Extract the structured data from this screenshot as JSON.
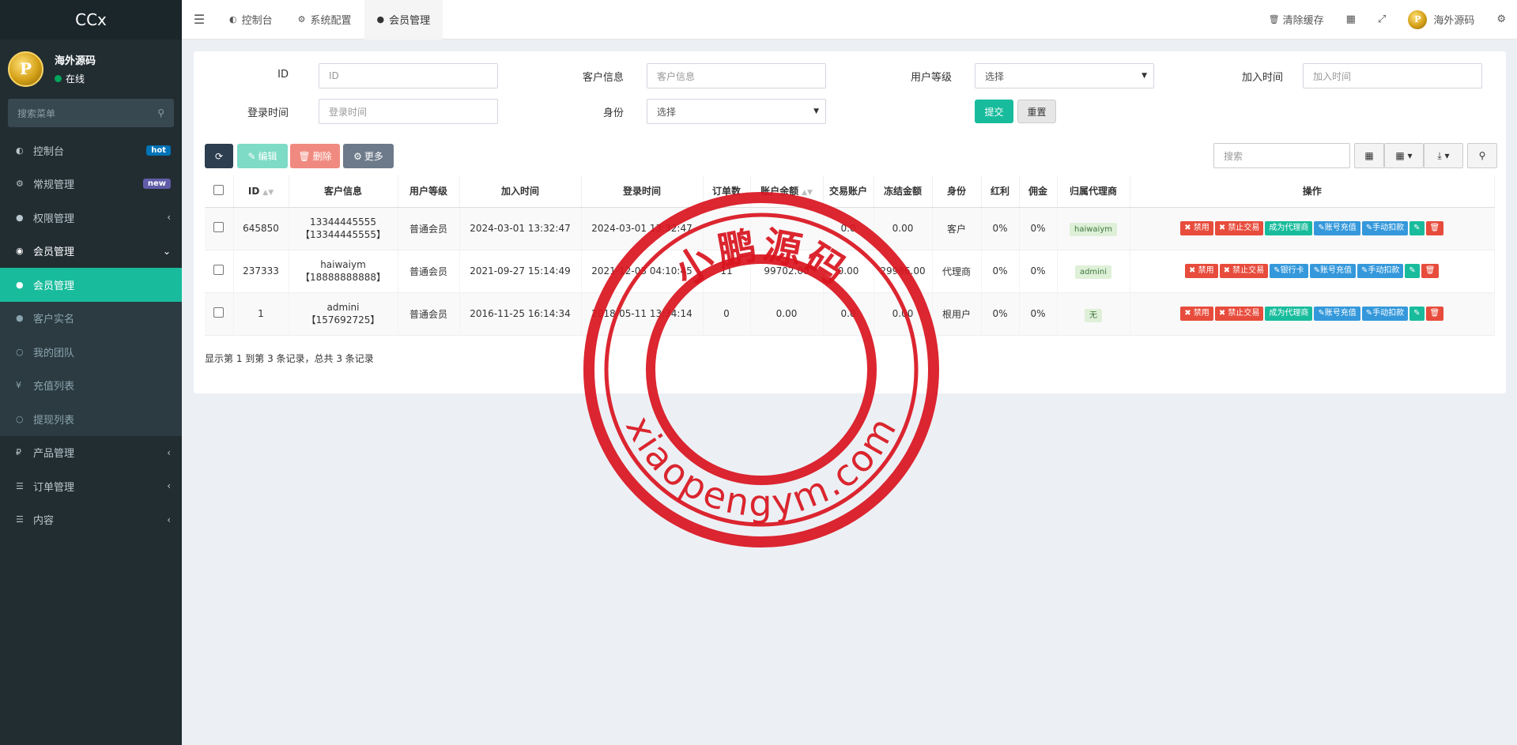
{
  "brand": "CCx",
  "user": {
    "name": "海外源码",
    "status": "在线",
    "avatar_letter": "P"
  },
  "sidebar": {
    "search_placeholder": "搜索菜单",
    "items": [
      {
        "label": "控制台",
        "icon": "dashboard-icon",
        "badge": "hot"
      },
      {
        "label": "常规管理",
        "icon": "cogs-icon",
        "badge": "new"
      },
      {
        "label": "权限管理",
        "icon": "group-icon"
      },
      {
        "label": "会员管理",
        "icon": "user-circle-icon"
      },
      {
        "label": "产品管理",
        "icon": "ruble-icon"
      },
      {
        "label": "订单管理",
        "icon": "list-icon"
      },
      {
        "label": "内容",
        "icon": "list-icon"
      }
    ],
    "submenu": [
      {
        "label": "会员管理",
        "icon": "user-icon"
      },
      {
        "label": "客户实名",
        "icon": "user-icon"
      },
      {
        "label": "我的团队",
        "icon": "circle-icon"
      },
      {
        "label": "充值列表",
        "icon": "yen-icon"
      },
      {
        "label": "提现列表",
        "icon": "circle-icon"
      }
    ]
  },
  "topnav": {
    "tabs": [
      {
        "label": "控制台"
      },
      {
        "label": "系统配置"
      },
      {
        "label": "会员管理"
      }
    ],
    "clear_cache": "清除缓存",
    "username": "海外源码"
  },
  "filters": {
    "id_label": "ID",
    "id_placeholder": "ID",
    "customer_label": "客户信息",
    "customer_placeholder": "客户信息",
    "level_label": "用户等级",
    "level_value": "选择",
    "join_label": "加入时间",
    "join_placeholder": "加入时间",
    "login_label": "登录时间",
    "login_placeholder": "登录时间",
    "role_label": "身份",
    "role_value": "选择",
    "submit": "提交",
    "reset": "重置"
  },
  "toolbar": {
    "edit": "编辑",
    "delete": "删除",
    "more": "更多",
    "search_placeholder": "搜索"
  },
  "table": {
    "headers": [
      "ID",
      "客户信息",
      "用户等级",
      "加入时间",
      "登录时间",
      "订单数",
      "账户余额",
      "交易账户",
      "冻结金额",
      "身份",
      "红利",
      "佣金",
      "归属代理商",
      "操作"
    ],
    "rows": [
      {
        "id": "645850",
        "info1": "13344445555",
        "info2": "【13344445555】",
        "level": "普通会员",
        "join": "2024-03-01 13:32:47",
        "login": "2024-03-01 13:32:47",
        "orders": "",
        "balance": "",
        "trade": "0.0",
        "frozen": "0.00",
        "role": "客户",
        "bonus": "0%",
        "commission": "0%",
        "agent": "haiwaiym",
        "actions": [
          "禁用",
          "禁止交易",
          "成为代理商",
          "账号充值",
          "手动扣款"
        ]
      },
      {
        "id": "237333",
        "info1": "haiwaiym",
        "info2": "【18888888888】",
        "level": "普通会员",
        "join": "2021-09-27 15:14:49",
        "login": "2021-12-03 04:10:45",
        "orders": "11",
        "balance": "99702.00",
        "trade": "0.00",
        "frozen": "29986.00",
        "role": "代理商",
        "bonus": "0%",
        "commission": "0%",
        "agent": "admini",
        "actions": [
          "禁用",
          "禁止交易",
          "银行卡",
          "账号充值",
          "手动扣款"
        ]
      },
      {
        "id": "1",
        "info1": "admini",
        "info2": "【157692725】",
        "level": "普通会员",
        "join": "2016-11-25 16:14:34",
        "login": "2018-05-11 13:34:14",
        "orders": "0",
        "balance": "0.00",
        "trade": "0.0",
        "frozen": "0.00",
        "role": "根用户",
        "bonus": "0%",
        "commission": "0%",
        "agent": "无",
        "actions": [
          "禁用",
          "禁止交易",
          "成为代理商",
          "账号充值",
          "手动扣款"
        ]
      }
    ],
    "footer": "显示第 1 到第 3 条记录，总共 3 条记录"
  },
  "watermark": {
    "top_text": "小鹏源码",
    "bottom_text": "xiaopengym.com"
  },
  "colors": {
    "accent": "#18bc9c",
    "sidebar": "#222d32",
    "stamp": "#d9141e"
  }
}
